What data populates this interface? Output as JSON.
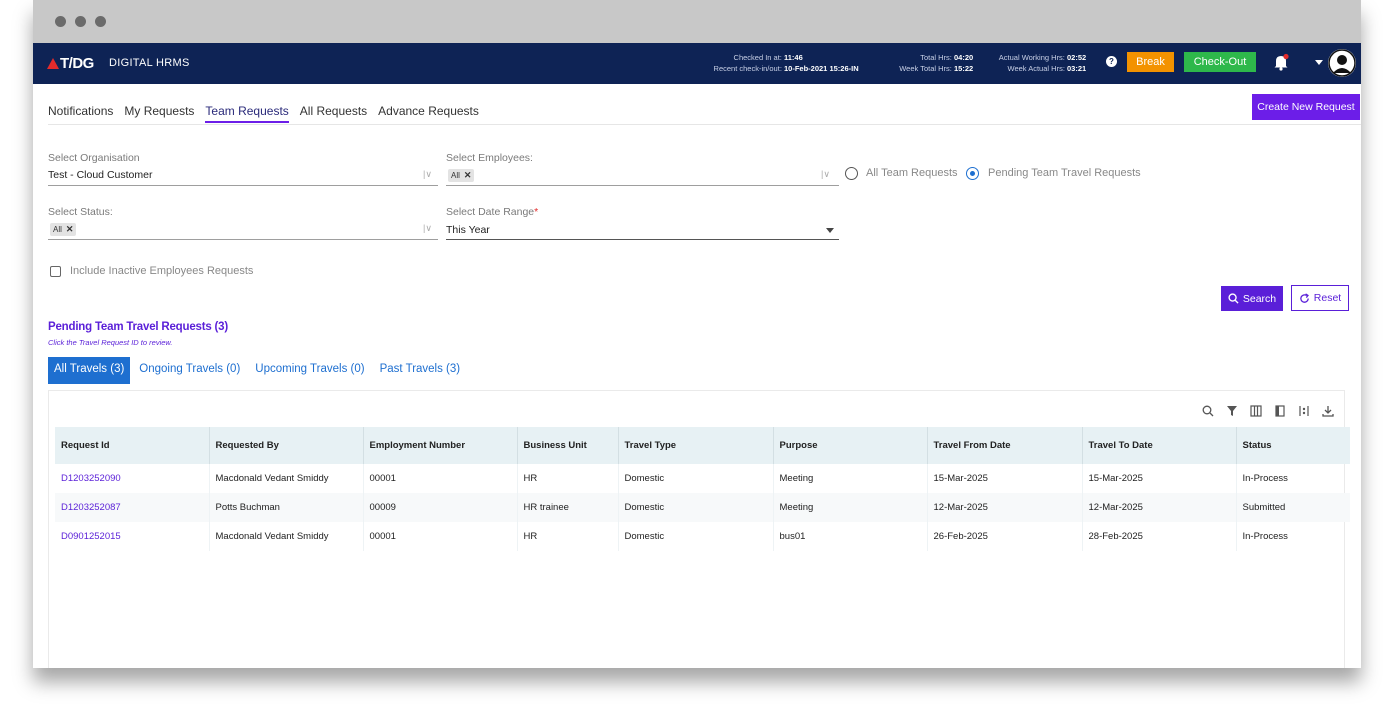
{
  "header": {
    "logo_text": "T/DG",
    "app_name": "DIGITAL HRMS",
    "checked_in_label": "Checked In at:",
    "checked_in_value": "11:46",
    "recent_label": "Recent check-in/out:",
    "recent_value": "10-Feb-2021 15:26-IN",
    "total_hrs_label": "Total Hrs:",
    "total_hrs_value": "04:20",
    "week_total_label": "Week Total Hrs:",
    "week_total_value": "15:22",
    "actual_label": "Actual Working Hrs:",
    "actual_value": "02:52",
    "week_actual_label": "Week Actual Hrs:",
    "week_actual_value": "03:21",
    "break_label": "Break",
    "checkout_label": "Check-Out",
    "help_glyph": "?"
  },
  "tabs": [
    "Notifications",
    "My Requests",
    "Team Requests",
    "All Requests",
    "Advance Requests"
  ],
  "create_button": "Create New Request",
  "filters": {
    "org_label": "Select Organisation",
    "org_value": "Test - Cloud Customer",
    "emp_label": "Select Employees:",
    "emp_chip": "All",
    "status_label": "Select Status:",
    "status_chip": "All",
    "date_label": "Select Date Range",
    "date_required": "*",
    "date_value": "This Year",
    "radio_all": "All Team Requests",
    "radio_pending": "Pending Team Travel Requests",
    "inactive_label": "Include Inactive Employees Requests"
  },
  "actions": {
    "search": "Search",
    "reset": "Reset"
  },
  "section": {
    "title": "Pending Team Travel Requests (3)",
    "note": "Click the Travel Request ID to review."
  },
  "travel_tabs": [
    "All Travels (3)",
    "Ongoing Travels (0)",
    "Upcoming Travels (0)",
    "Past Travels (3)"
  ],
  "table": {
    "columns": [
      "Request Id",
      "Requested By",
      "Employment Number",
      "Business Unit",
      "Travel Type",
      "Purpose",
      "Travel From Date",
      "Travel To Date",
      "Status"
    ],
    "rows": [
      [
        "D1203252090",
        "Macdonald Vedant Smiddy",
        "00001",
        "HR",
        "Domestic",
        "Meeting",
        "15-Mar-2025",
        "15-Mar-2025",
        "In-Process"
      ],
      [
        "D1203252087",
        "Potts Buchman",
        "00009",
        "HR trainee",
        "Domestic",
        "Meeting",
        "12-Mar-2025",
        "12-Mar-2025",
        "Submitted"
      ],
      [
        "D0901252015",
        "Macdonald Vedant Smiddy",
        "00001",
        "HR",
        "Domestic",
        "bus01",
        "26-Feb-2025",
        "28-Feb-2025",
        "In-Process"
      ]
    ]
  },
  "colors": {
    "nav": "#0e2355",
    "accent": "#6c1ee8",
    "link": "#1e6fd0",
    "break": "#f39200",
    "checkout": "#2eb84b"
  }
}
